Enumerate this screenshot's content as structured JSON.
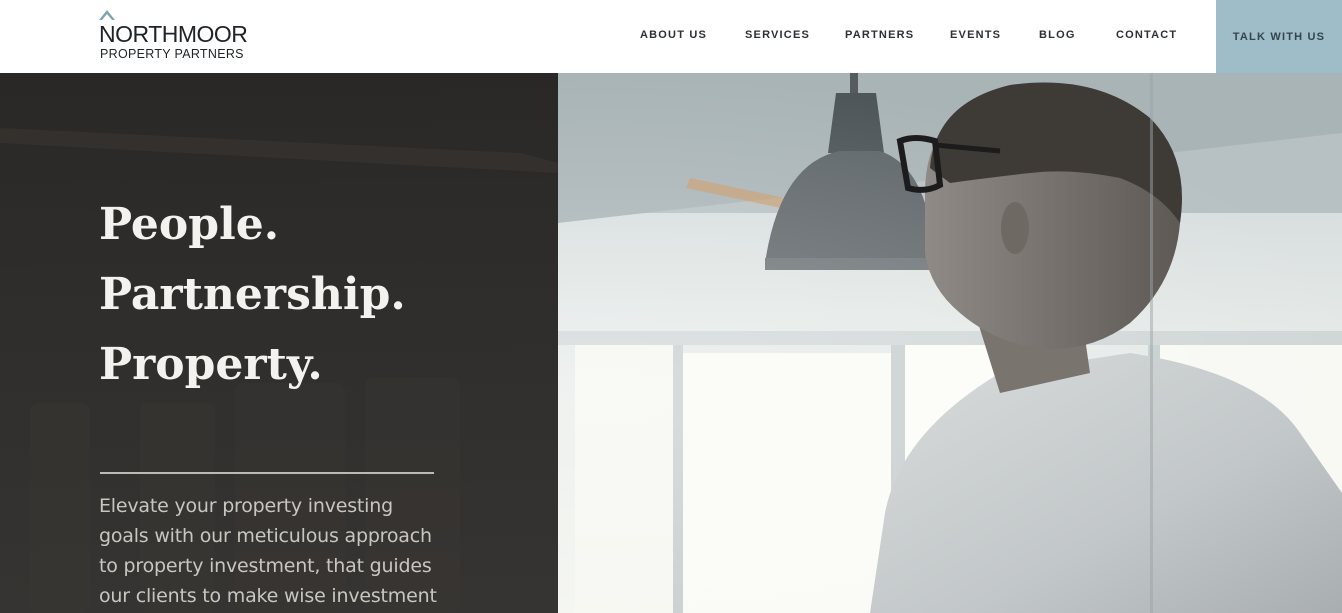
{
  "brand": {
    "name": "NORTHMOOR",
    "subtitle": "PROPERTY PARTNERS",
    "mark_color": "#7fa3b5"
  },
  "nav": {
    "items": [
      {
        "label": "ABOUT US"
      },
      {
        "label": "SERVICES"
      },
      {
        "label": "PARTNERS"
      },
      {
        "label": "EVENTS"
      },
      {
        "label": "BLOG"
      },
      {
        "label": "CONTACT"
      }
    ],
    "cta_label": "TALK WITH US",
    "cta_color": "#9fbcc9"
  },
  "hero": {
    "tagline": [
      "People.",
      "Partnership.",
      "Property."
    ],
    "intro": "Elevate your property investing goals with our meticulous approach to property investment, that guides our clients to make wise investment",
    "panel_color": "#2a2826",
    "photo_subject": "man-with-glasses-office-window"
  }
}
